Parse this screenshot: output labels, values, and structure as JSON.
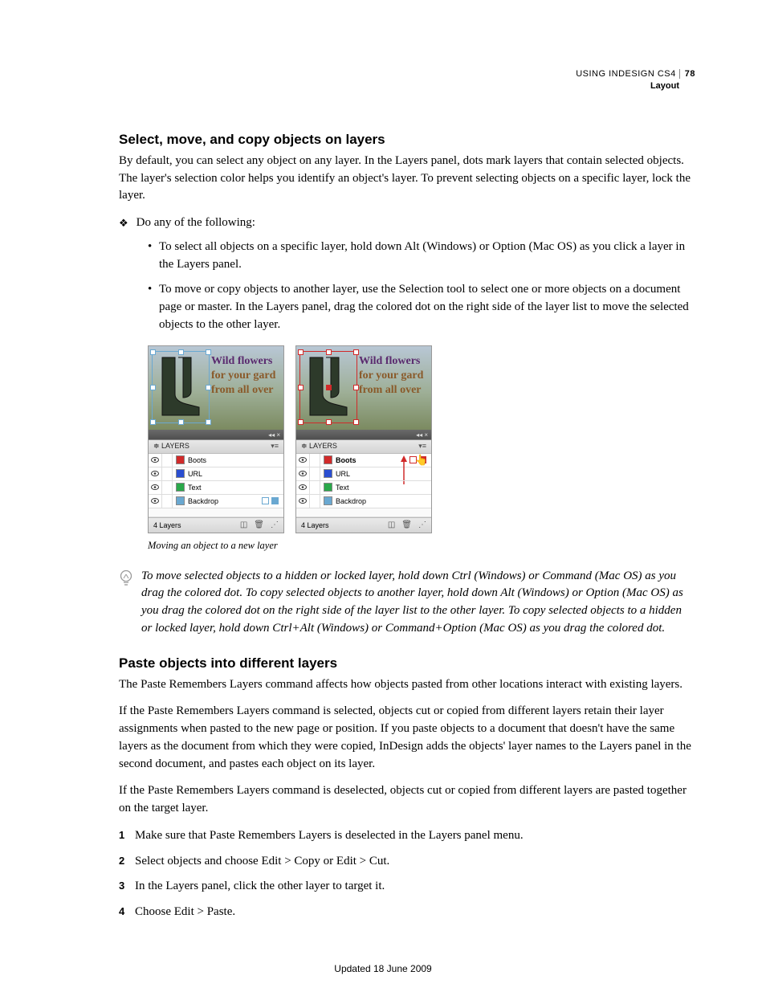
{
  "header": {
    "product": "USING INDESIGN CS4",
    "section": "Layout",
    "page_number": "78"
  },
  "section1": {
    "heading": "Select, move, and copy objects on layers",
    "intro": "By default, you can select any object on any layer. In the Layers panel, dots mark layers that contain selected objects. The layer's selection color helps you identify an object's layer. To prevent selecting objects on a specific layer, lock the layer.",
    "diamond": "Do any of the following:",
    "bullets": [
      "To select all objects on a specific layer, hold down Alt (Windows) or Option (Mac OS) as you click a layer in the Layers panel.",
      "To move or copy objects to another layer, use the Selection tool to select one or more objects on a document page or master. In the Layers panel, drag the colored dot on the right side of the layer list to move the selected objects to the other layer."
    ]
  },
  "figure": {
    "overlay_text": {
      "line1": "Wild flowers",
      "line2": "for your gard",
      "line3": "from all over"
    },
    "panel_title": "LAYERS",
    "layers": [
      {
        "name": "Boots",
        "color": "#d12a2a"
      },
      {
        "name": "URL",
        "color": "#2a4ed1"
      },
      {
        "name": "Text",
        "color": "#2aa84a"
      },
      {
        "name": "Backdrop",
        "color": "#6aa8d1"
      }
    ],
    "footer_count": "4 Layers",
    "caption": "Moving an object to a new layer"
  },
  "tip": "To move selected objects to a hidden or locked layer, hold down Ctrl (Windows) or Command (Mac OS) as you drag the colored dot. To copy selected objects to another layer, hold down Alt (Windows) or Option (Mac OS) as you drag the colored dot on the right side of the layer list to the other layer. To copy selected objects to a hidden or locked layer, hold down Ctrl+Alt (Windows) or Command+Option (Mac OS) as you drag the colored dot.",
  "section2": {
    "heading": "Paste objects into different layers",
    "p1": "The Paste Remembers Layers command affects how objects pasted from other locations interact with existing layers.",
    "p2": "If the Paste Remembers Layers command is selected, objects cut or copied from different layers retain their layer assignments when pasted to the new page or position. If you paste objects to a document that doesn't have the same layers as the document from which they were copied, InDesign adds the objects' layer names to the Layers panel in the second document, and pastes each object on its layer.",
    "p3": "If the Paste Remembers Layers command is deselected, objects cut or copied from different layers are pasted together on the target layer.",
    "steps": [
      "Make sure that Paste Remembers Layers is deselected in the Layers panel menu.",
      "Select objects and choose Edit > Copy or Edit > Cut.",
      "In the Layers panel, click the other layer to target it.",
      "Choose Edit > Paste."
    ]
  },
  "footer": {
    "updated": "Updated 18 June 2009"
  }
}
